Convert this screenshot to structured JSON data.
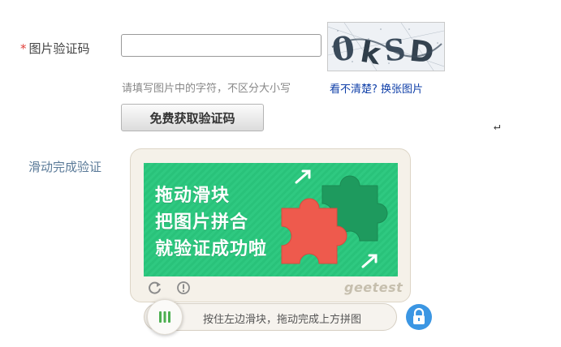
{
  "image_captcha": {
    "required_mark": "*",
    "label": "图片验证码",
    "input_value": "",
    "input_placeholder": "",
    "hint": "请填写图片中的字符，不区分大小写",
    "refresh_link": "看不清楚? 换张图片"
  },
  "sms": {
    "button_label": "免费获取验证码"
  },
  "cursor_glyph": "↵",
  "slide_captcha": {
    "label": "滑动完成验证",
    "image_text": [
      "拖动滑块",
      "把图片拼合",
      "就验证成功啦"
    ],
    "brand": "geetest",
    "slider_text": "按住左边滑块，拖动完成上方拼图",
    "progress": 0
  },
  "colors": {
    "required": "#e1403a",
    "link": "#0f3fa8",
    "label_blue": "#5a7a98",
    "puzzle_green": "#29c27a",
    "puzzle_red": "#ee5a4d",
    "lock_blue": "#3b96e3",
    "knob_green": "#4caf50"
  },
  "icons": {
    "panel_refresh": "refresh-icon",
    "panel_info": "info-icon",
    "lock": "lock-icon",
    "knob": "grip-bars-icon"
  }
}
